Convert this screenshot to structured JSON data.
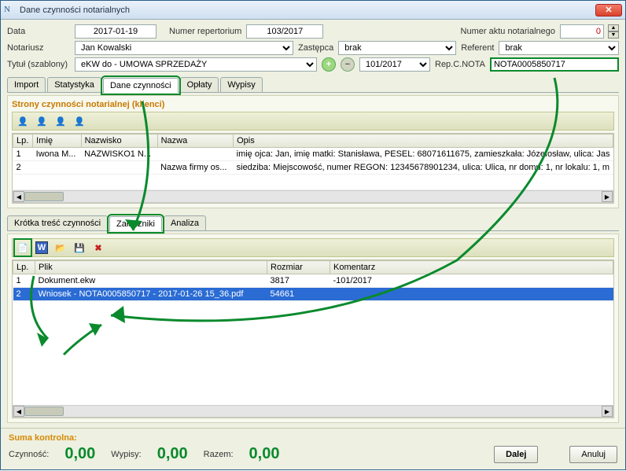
{
  "window": {
    "title": "Dane czynności notarialnych",
    "icon_letter": "N"
  },
  "header": {
    "data_label": "Data",
    "data_value": "2017-01-19",
    "numrep_label": "Numer repertorium",
    "numrep_value": "103/2017",
    "numakt_label": "Numer aktu notarialnego",
    "numakt_value": "0",
    "notariusz_label": "Notariusz",
    "notariusz_value": "Jan  Kowalski",
    "zastepca_label": "Zastępca",
    "zastepca_value": "brak",
    "referent_label": "Referent",
    "referent_value": "brak",
    "tytul_label": "Tytuł (szablony)",
    "tytul_value": "eKW do - UMOWA SPRZEDAŻY",
    "period_value": "101/2017",
    "rep_label": "Rep.C.NOTA",
    "rep_value": "NOTA0005850717"
  },
  "tabs_main": {
    "items": [
      "Import",
      "Statystyka",
      "Dane czynności",
      "Opłaty",
      "Wypisy"
    ]
  },
  "clients": {
    "title": "Strony czynności notarialnej (klienci)",
    "cols": {
      "lp": "Lp.",
      "imie": "Imię",
      "nazwisko": "Nazwisko",
      "nazwa": "Nazwa",
      "opis": "Opis"
    },
    "rows": [
      {
        "lp": "1",
        "imie": "Iwona M...",
        "nazwisko": "NAZWISKO1 N...",
        "nazwa": "",
        "opis": "imię ojca: Jan, imię matki: Stanisława, PESEL: 68071611675, zamieszkała: Józefosław, ulica: Jas"
      },
      {
        "lp": "2",
        "imie": "",
        "nazwisko": "",
        "nazwa": "Nazwa firmy os...",
        "opis": "siedziba:  Miejscowość, numer REGON: 12345678901234, ulica: Ulica, nr domu: 1, nr lokalu: 1, m"
      }
    ]
  },
  "subtabs": {
    "items": [
      "Krótka treść czynności",
      "Załączniki",
      "Analiza"
    ]
  },
  "attachments": {
    "cols": {
      "lp": "Lp.",
      "plik": "Plik",
      "rozmiar": "Rozmiar",
      "komentarz": "Komentarz"
    },
    "rows": [
      {
        "lp": "1",
        "plik": "Dokument.ekw",
        "rozmiar": "3817",
        "komentarz": "-101/2017"
      },
      {
        "lp": "2",
        "plik": "Wniosek - NOTA0005850717 - 2017-01-26 15_36.pdf",
        "rozmiar": "54661",
        "komentarz": ""
      }
    ]
  },
  "footer": {
    "suma_label": "Suma kontrolna:",
    "czynnosc_label": "Czynność:",
    "czynnosc_value": "0,00",
    "wypisy_label": "Wypisy:",
    "wypisy_value": "0,00",
    "razem_label": "Razem:",
    "razem_value": "0,00",
    "dalej": "Dalej",
    "anuluj": "Anuluj"
  }
}
